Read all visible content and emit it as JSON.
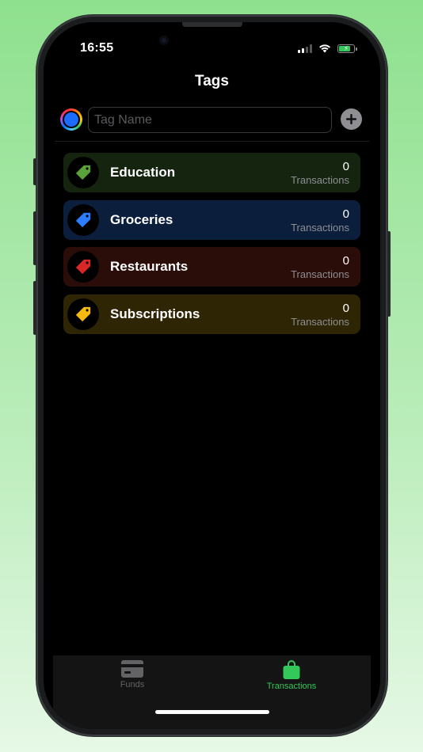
{
  "status_bar": {
    "time": "16:55"
  },
  "header": {
    "title": "Tags"
  },
  "new_tag": {
    "placeholder": "Tag Name",
    "value": "",
    "selected_color": "#1e6bff"
  },
  "tags": [
    {
      "name": "Education",
      "count": "0",
      "count_label": "Transactions",
      "color": "#5aa13a",
      "bg": "#14240f"
    },
    {
      "name": "Groceries",
      "count": "0",
      "count_label": "Transactions",
      "color": "#2b7cff",
      "bg": "#0b1f3d"
    },
    {
      "name": "Restaurants",
      "count": "0",
      "count_label": "Transactions",
      "color": "#d92626",
      "bg": "#2a0c08"
    },
    {
      "name": "Subscriptions",
      "count": "0",
      "count_label": "Transactions",
      "color": "#f5b80f",
      "bg": "#2e2504"
    }
  ],
  "tab_bar": {
    "items": [
      {
        "label": "Funds",
        "icon": "credit-card-icon",
        "active": false,
        "color": "#636366"
      },
      {
        "label": "Transactions",
        "icon": "shopping-bag-icon",
        "active": true,
        "color": "#34c759"
      }
    ]
  }
}
